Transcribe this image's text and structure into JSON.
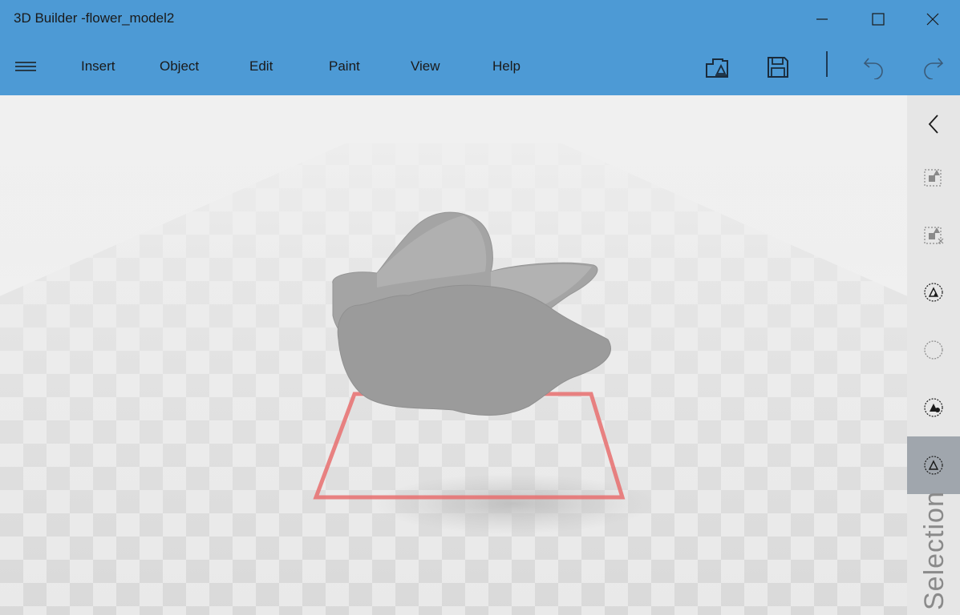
{
  "window": {
    "title": "3D Builder -flower_model2",
    "controls": [
      "minimize-icon",
      "maximize-icon",
      "close-icon"
    ]
  },
  "menubar": {
    "items": [
      {
        "label": "Insert"
      },
      {
        "label": "Object"
      },
      {
        "label": "Edit"
      },
      {
        "label": "Paint"
      },
      {
        "label": "View"
      },
      {
        "label": "Help"
      }
    ],
    "tools": [
      "scene-icon",
      "save-icon",
      "undo-icon",
      "redo-icon"
    ]
  },
  "colors": {
    "accent": "#4d9ad5",
    "selection_outline": "#e86e6e",
    "model": "#9d9d9d",
    "panel": "#e6e6e6",
    "panel_active": "#a0a6ad"
  },
  "sidepanel": {
    "buttons": [
      "collapse-chevron-icon",
      "select-objects-icon",
      "select-remove-icon",
      "select-faces-icon",
      "select-vertices-icon",
      "select-fill-icon",
      "select-triangle-icon"
    ],
    "active": "select-triangle-icon",
    "label": "Selection"
  }
}
